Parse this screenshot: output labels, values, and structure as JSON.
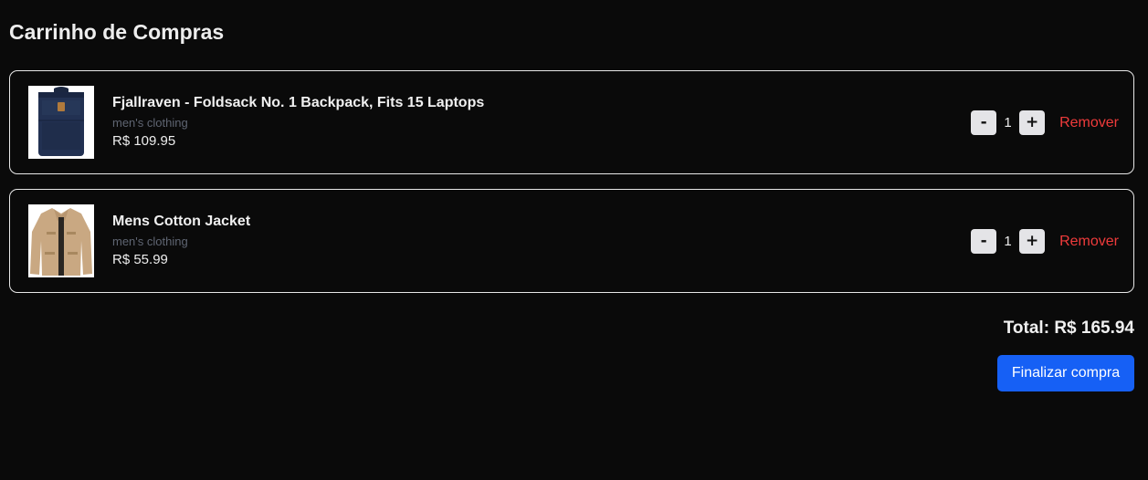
{
  "page": {
    "title": "Carrinho de Compras"
  },
  "cart": {
    "items": [
      {
        "title": "Fjallraven - Foldsack No. 1 Backpack, Fits 15 Laptops",
        "category": "men's clothing",
        "price": "R$ 109.95",
        "quantity": "1",
        "decrement_label": "-",
        "increment_label": "+",
        "remove_label": "Remover",
        "image_icon": "backpack-icon"
      },
      {
        "title": "Mens Cotton Jacket",
        "category": "men's clothing",
        "price": "R$ 55.99",
        "quantity": "1",
        "decrement_label": "-",
        "increment_label": "+",
        "remove_label": "Remover",
        "image_icon": "jacket-icon"
      }
    ],
    "total": "Total: R$ 165.94",
    "checkout_label": "Finalizar compra"
  },
  "colors": {
    "background": "#0a0a0a",
    "accent": "#1660f5",
    "remove": "#ef3b3b",
    "muted": "#5f6572"
  }
}
